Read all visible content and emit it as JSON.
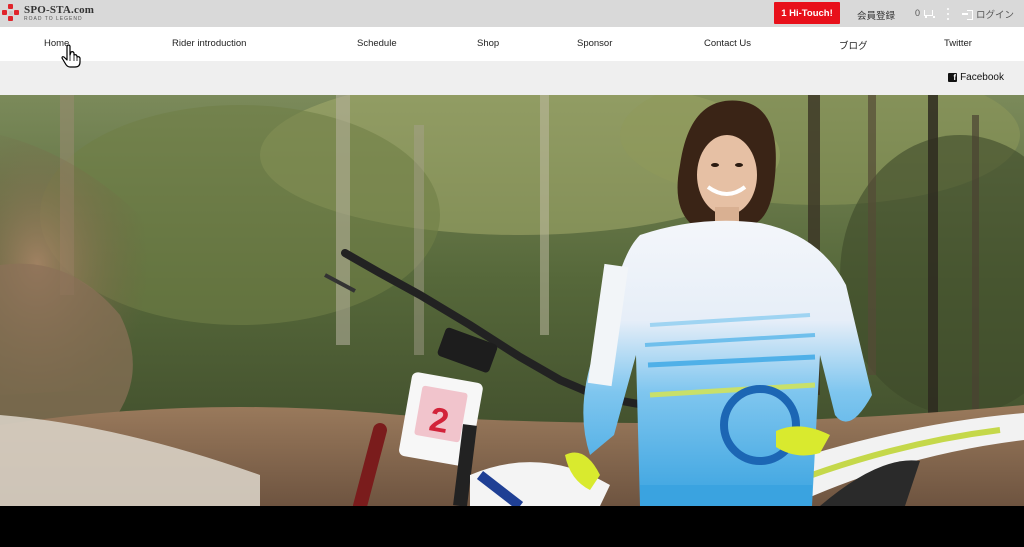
{
  "topbar": {
    "logo_name": "SPO-STA.com",
    "logo_tagline": "ROAD TO LEGEND",
    "hitouch_label": "1 Hi-Touch!",
    "register_label": "会員登録",
    "cart_count": "0",
    "login_label": "ログイン"
  },
  "nav": {
    "items": [
      {
        "label": "Home"
      },
      {
        "label": "Rider introduction"
      },
      {
        "label": "Schedule"
      },
      {
        "label": "Shop"
      },
      {
        "label": "Sponsor"
      },
      {
        "label": "Contact Us"
      },
      {
        "label": "ブログ"
      },
      {
        "label": "Twitter"
      }
    ]
  },
  "subbar": {
    "facebook_label": "Facebook"
  },
  "hero": {
    "number_plate": "2"
  },
  "colors": {
    "brand_red": "#e8101a",
    "topbar_bg": "#d9d9d9",
    "subbar_bg": "#efefef"
  },
  "icons": {
    "logo": "snowflake-dots-logo-icon",
    "cart": "cart-icon",
    "more": "kebab-icon",
    "login": "login-icon",
    "facebook": "facebook-icon",
    "cursor": "hand-pointer-icon"
  }
}
